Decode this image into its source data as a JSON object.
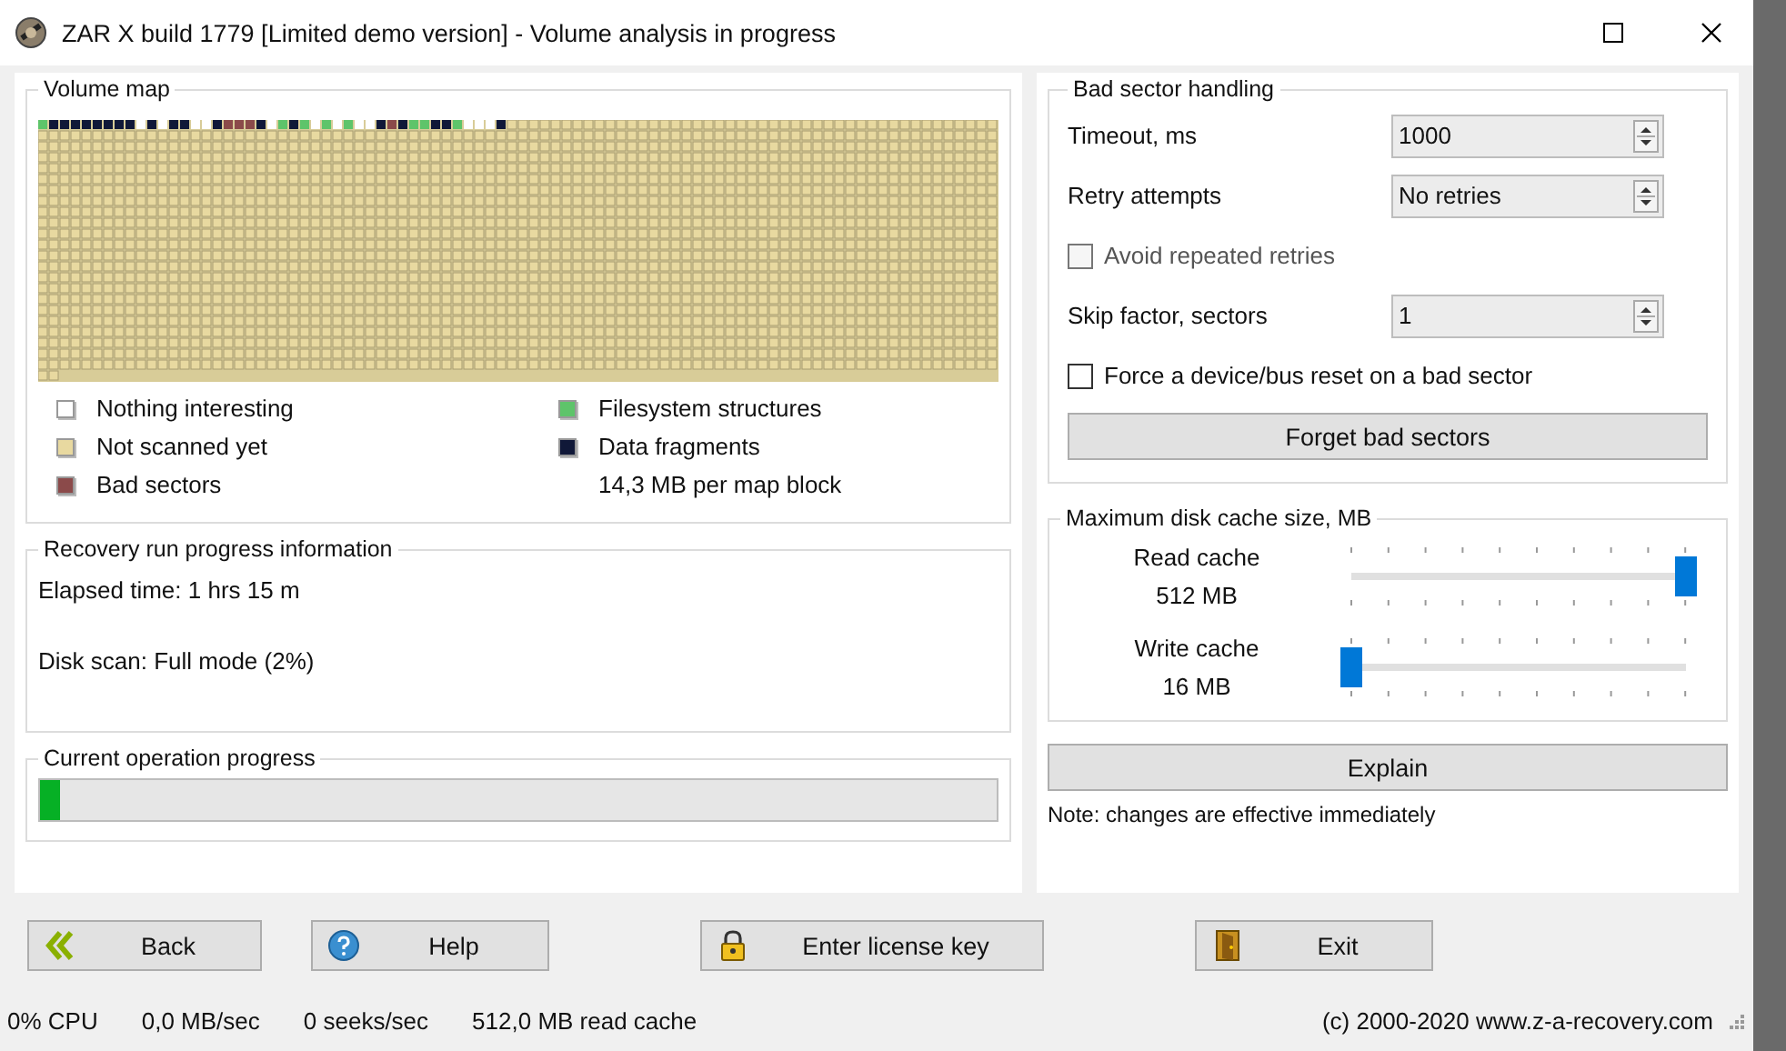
{
  "window": {
    "title": "ZAR X build 1779 [Limited demo version] - Volume analysis in progress"
  },
  "volume_map": {
    "title": "Volume map",
    "legend": [
      {
        "kind": "empty",
        "label": "Nothing interesting",
        "color": "#ffffff"
      },
      {
        "kind": "unscanned",
        "label": "Not scanned yet",
        "color": "#e8d9a0"
      },
      {
        "kind": "bad",
        "label": "Bad sectors",
        "color": "#8b4a4a"
      },
      {
        "kind": "filesystem",
        "label": "Filesystem structures",
        "color": "#5ec46a"
      },
      {
        "kind": "fragment",
        "label": "Data fragments",
        "color": "#101838"
      }
    ],
    "block_size": "14,3 MB per map block",
    "scanned_blocks": [
      {
        "color": "#5ec46a"
      },
      {
        "color": "#101838"
      },
      {
        "color": "#101838"
      },
      {
        "color": "#101838"
      },
      {
        "color": "#101838"
      },
      {
        "color": "#101838"
      },
      {
        "color": "#101838"
      },
      {
        "color": "#101838"
      },
      {
        "color": "#101838"
      },
      {
        "color": "#ffffff"
      },
      {
        "color": "#101838"
      },
      {
        "color": "#ffffff"
      },
      {
        "color": "#101838"
      },
      {
        "color": "#101838"
      },
      {
        "color": "#ffffff"
      },
      {
        "color": "#ffffff"
      },
      {
        "color": "#101838"
      },
      {
        "color": "#8b4a4a"
      },
      {
        "color": "#8b4a4a"
      },
      {
        "color": "#8b4a4a"
      },
      {
        "color": "#101838"
      },
      {
        "color": "#ffffff"
      },
      {
        "color": "#5ec46a"
      },
      {
        "color": "#101838"
      },
      {
        "color": "#5ec46a"
      },
      {
        "color": "#ffffff"
      },
      {
        "color": "#5ec46a"
      },
      {
        "color": "#ffffff"
      },
      {
        "color": "#5ec46a"
      },
      {
        "color": "#ffffff"
      },
      {
        "color": "#ffffff"
      },
      {
        "color": "#101838"
      },
      {
        "color": "#8b4a4a"
      },
      {
        "color": "#101838"
      },
      {
        "color": "#5ec46a"
      },
      {
        "color": "#5ec46a"
      },
      {
        "color": "#101838"
      },
      {
        "color": "#101838"
      },
      {
        "color": "#5ec46a"
      },
      {
        "color": "#ffffff"
      },
      {
        "color": "#ffffff"
      },
      {
        "color": "#ffffff"
      },
      {
        "color": "#101838"
      }
    ]
  },
  "progress_info": {
    "title": "Recovery run progress information",
    "lines": [
      "Elapsed time: 1 hrs 15 m",
      "Disk scan: Full mode (2%)"
    ]
  },
  "current_operation": {
    "title": "Current operation progress",
    "level": 0.02
  },
  "bad_sector_handling": {
    "title": "Bad sector handling",
    "rows": [
      {
        "kind": "spin",
        "label": "Timeout, ms",
        "value": "1000"
      },
      {
        "kind": "spin",
        "label": "Retry attempts",
        "value": "No retries"
      },
      {
        "kind": "check",
        "label": "Avoid repeated retries",
        "checked": false,
        "disabled": true
      },
      {
        "kind": "spin",
        "label": "Skip factor, sectors",
        "value": "1"
      },
      {
        "kind": "check",
        "label": "Force a device/bus reset on a bad sector",
        "checked": false,
        "disabled": false
      }
    ],
    "button": "Forget bad sectors"
  },
  "disk_cache": {
    "title": "Maximum disk cache size, MB",
    "sliders": [
      {
        "label": "Read cache",
        "reading": "512 MB",
        "level": 1.0
      },
      {
        "label": "Write cache",
        "reading": "16 MB",
        "level": 0.0
      }
    ]
  },
  "explain_button": "Explain",
  "note": "Note: changes are effective immediately",
  "buttons": [
    {
      "kind": "back",
      "label": "Back"
    },
    {
      "kind": "help",
      "label": "Help"
    },
    {
      "kind": "license",
      "label": "Enter license key"
    },
    {
      "kind": "exit",
      "label": "Exit"
    }
  ],
  "status_bar": {
    "items": [
      "0% CPU",
      "0,0 MB/sec",
      "0 seeks/sec",
      "512,0 MB read cache"
    ],
    "copyright": "(c) 2000-2020 www.z-a-recovery.com"
  }
}
